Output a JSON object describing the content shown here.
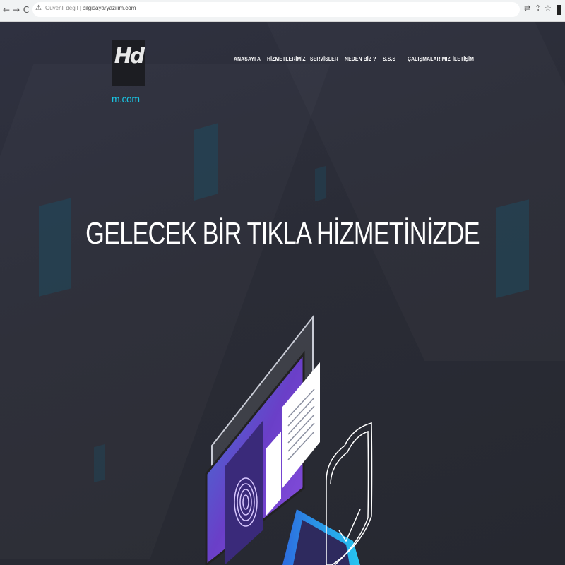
{
  "browser": {
    "back_icon": "←",
    "forward_icon": "→",
    "reload_icon": "C",
    "security_label": "Güvenli değil",
    "url": "bilgisayaryazilim.com",
    "icons": [
      "translate-icon",
      "share-icon",
      "star-icon",
      "window-icon"
    ]
  },
  "site": {
    "logo_mark": "Hd",
    "logo_sub": "m.com",
    "accent": "#19c4e3"
  },
  "menu": {
    "items": [
      {
        "label": "ANASAYFA",
        "active": true
      },
      {
        "label": "HİZMETLERİMİZ",
        "active": false
      },
      {
        "label": "SERVİSLER",
        "active": false
      },
      {
        "label": "NEDEN BİZ ?",
        "active": false
      },
      {
        "label": "S.S.S",
        "active": false
      },
      {
        "label": "ÇALIŞMALARIMIZ",
        "active": false
      },
      {
        "label": "İLETİŞİM",
        "active": false
      }
    ]
  },
  "hero": {
    "headline": "GELECEK BİR TIKLA HİZMETİNİZDE"
  }
}
